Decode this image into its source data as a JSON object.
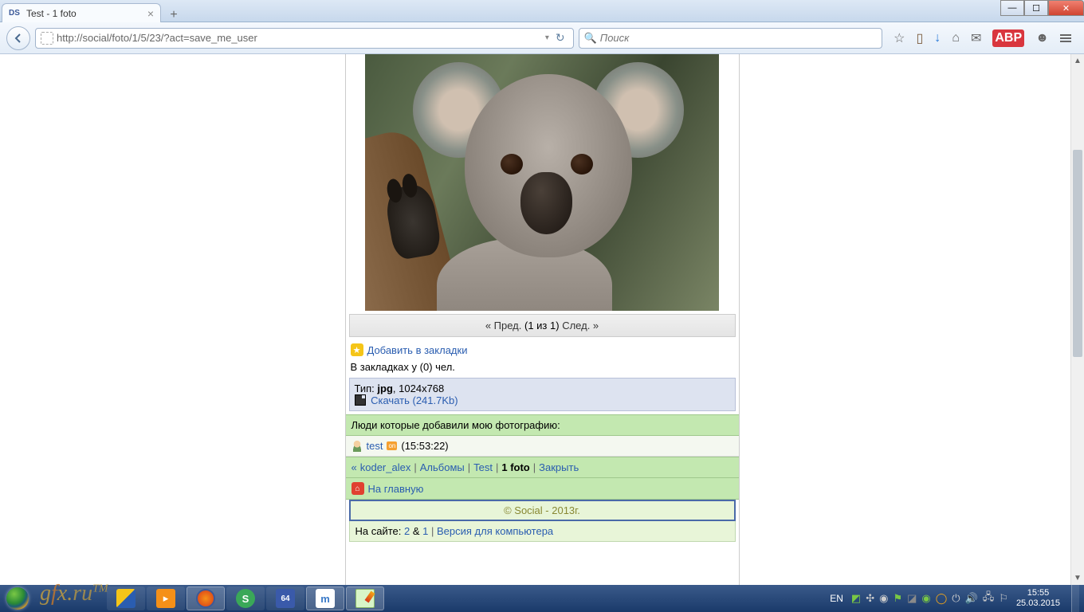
{
  "window": {
    "tab_title": "Test - 1 foto",
    "tab_favicon": "DS"
  },
  "browser": {
    "url": "http://social/foto/1/5/23/?act=save_me_user",
    "search_placeholder": "Поиск"
  },
  "page": {
    "pager": {
      "prev": "« Пред.",
      "counter": "(1 из 1)",
      "next": "След. »"
    },
    "bookmark": {
      "add_label": "Добавить в закладки",
      "count_label": "В закладках у (0) чел."
    },
    "file": {
      "type_label": "Тип:",
      "type_value": "jpg",
      "dimensions": ", 1024x768",
      "download_label": "Скачать (241.7Kb)"
    },
    "whoadded_header": "Люди которые добавили мою фотографию:",
    "whoadded_user": {
      "name": "test",
      "status": "on",
      "time": "(15:53:22)"
    },
    "breadcrumb": {
      "arrows": "«",
      "user": "koder_alex",
      "albums": "Альбомы",
      "album": "Test",
      "current": "1 foto",
      "close": "Закрыть"
    },
    "home_label": "На главную",
    "copyright": "© Social - 2013г.",
    "stats": {
      "prefix": "На сайте:",
      "v1": "2",
      "amp": "&",
      "v2": "1",
      "desktop_label": "Версия для компьютера"
    }
  },
  "taskbar": {
    "lang": "EN",
    "time": "15:55",
    "date": "25.03.2015"
  }
}
